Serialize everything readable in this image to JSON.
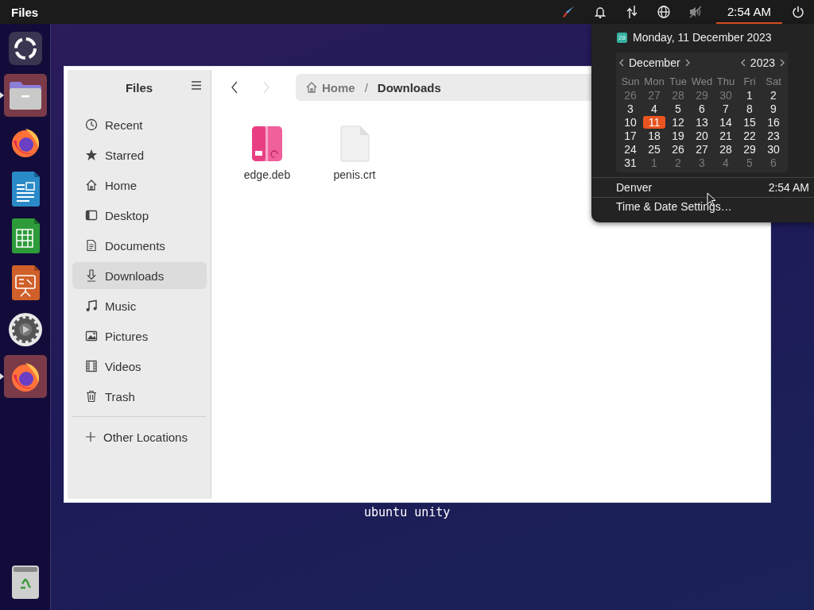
{
  "top_bar": {
    "app_name": "Files",
    "indicators": [
      {
        "kind": "brush"
      },
      {
        "kind": "bell"
      },
      {
        "kind": "network"
      },
      {
        "kind": "globe"
      },
      {
        "kind": "muted"
      }
    ],
    "clock": {
      "label": "2:54 AM",
      "selected": true
    }
  },
  "dock": {
    "items": [
      {
        "kind": "apps",
        "running": false,
        "focused": false
      },
      {
        "kind": "files",
        "running": true,
        "focused": true
      },
      {
        "kind": "firefox",
        "running": false,
        "focused": false
      },
      {
        "kind": "writer",
        "running": false,
        "focused": false
      },
      {
        "kind": "calc",
        "running": false,
        "focused": false
      },
      {
        "kind": "impress",
        "running": false,
        "focused": false
      },
      {
        "kind": "settings",
        "running": false,
        "focused": false
      },
      {
        "kind": "firefox",
        "running": true,
        "focused": true
      }
    ],
    "trash": {
      "kind": "trash"
    }
  },
  "desktop": {
    "label": "ubuntu unity"
  },
  "window": {
    "sidebar": {
      "title": "Files",
      "items": [
        {
          "kind": "recent",
          "label": "Recent",
          "selected": false
        },
        {
          "kind": "star",
          "label": "Starred",
          "selected": false
        },
        {
          "kind": "home",
          "label": "Home",
          "selected": false
        },
        {
          "kind": "desktop",
          "label": "Desktop",
          "selected": false
        },
        {
          "kind": "documents",
          "label": "Documents",
          "selected": false
        },
        {
          "kind": "downloads",
          "label": "Downloads",
          "selected": true
        },
        {
          "kind": "music",
          "label": "Music",
          "selected": false
        },
        {
          "kind": "pictures",
          "label": "Pictures",
          "selected": false
        },
        {
          "kind": "videos",
          "label": "Videos",
          "selected": false
        },
        {
          "kind": "trash",
          "label": "Trash",
          "selected": false
        }
      ],
      "other": {
        "label": "Other Locations"
      }
    },
    "nav": {
      "back_disabled": false,
      "forward_disabled": true
    },
    "path": [
      {
        "label": "Home",
        "current": false
      },
      {
        "label": "Downloads",
        "current": true
      }
    ],
    "separator": "/",
    "files": [
      {
        "kind": "package",
        "name": "edge.deb"
      },
      {
        "kind": "blank",
        "name": "penis.crt"
      }
    ]
  },
  "calendar_popup": {
    "date": "Monday, 11 December 2023",
    "date_icon": "28",
    "month": "December",
    "year": "2023",
    "weekdays": [
      "Sun",
      "Mon",
      "Tue",
      "Wed",
      "Thu",
      "Fri",
      "Sat"
    ],
    "weeks": [
      [
        {
          "day": "26",
          "other_month": true,
          "selected": false
        },
        {
          "day": "27",
          "other_month": true,
          "selected": false
        },
        {
          "day": "28",
          "other_month": true,
          "selected": false
        },
        {
          "day": "29",
          "other_month": true,
          "selected": false
        },
        {
          "day": "30",
          "other_month": true,
          "selected": false
        },
        {
          "day": "1",
          "other_month": false,
          "selected": false
        },
        {
          "day": "2",
          "other_month": false,
          "selected": false
        }
      ],
      [
        {
          "day": "3",
          "other_month": false,
          "selected": false
        },
        {
          "day": "4",
          "other_month": false,
          "selected": false
        },
        {
          "day": "5",
          "other_month": false,
          "selected": false
        },
        {
          "day": "6",
          "other_month": false,
          "selected": false
        },
        {
          "day": "7",
          "other_month": false,
          "selected": false
        },
        {
          "day": "8",
          "other_month": false,
          "selected": false
        },
        {
          "day": "9",
          "other_month": false,
          "selected": false
        }
      ],
      [
        {
          "day": "10",
          "other_month": false,
          "selected": false
        },
        {
          "day": "11",
          "other_month": false,
          "selected": true
        },
        {
          "day": "12",
          "other_month": false,
          "selected": false
        },
        {
          "day": "13",
          "other_month": false,
          "selected": false
        },
        {
          "day": "14",
          "other_month": false,
          "selected": false
        },
        {
          "day": "15",
          "other_month": false,
          "selected": false
        },
        {
          "day": "16",
          "other_month": false,
          "selected": false
        }
      ],
      [
        {
          "day": "17",
          "other_month": false,
          "selected": false
        },
        {
          "day": "18",
          "other_month": false,
          "selected": false
        },
        {
          "day": "19",
          "other_month": false,
          "selected": false
        },
        {
          "day": "20",
          "other_month": false,
          "selected": false
        },
        {
          "day": "21",
          "other_month": false,
          "selected": false
        },
        {
          "day": "22",
          "other_month": false,
          "selected": false
        },
        {
          "day": "23",
          "other_month": false,
          "selected": false
        }
      ],
      [
        {
          "day": "24",
          "other_month": false,
          "selected": false
        },
        {
          "day": "25",
          "other_month": false,
          "selected": false
        },
        {
          "day": "26",
          "other_month": false,
          "selected": false
        },
        {
          "day": "27",
          "other_month": false,
          "selected": false
        },
        {
          "day": "28",
          "other_month": false,
          "selected": false
        },
        {
          "day": "29",
          "other_month": false,
          "selected": false
        },
        {
          "day": "30",
          "other_month": false,
          "selected": false
        }
      ],
      [
        {
          "day": "31",
          "other_month": false,
          "selected": false
        },
        {
          "day": "1",
          "other_month": true,
          "selected": false
        },
        {
          "day": "2",
          "other_month": true,
          "selected": false
        },
        {
          "day": "3",
          "other_month": true,
          "selected": false
        },
        {
          "day": "4",
          "other_month": true,
          "selected": false
        },
        {
          "day": "5",
          "other_month": true,
          "selected": false
        },
        {
          "day": "6",
          "other_month": true,
          "selected": false
        }
      ]
    ],
    "world_clock": {
      "city": "Denver",
      "time": "2:54 AM"
    },
    "settings_link": "Time & Date Settings…"
  }
}
